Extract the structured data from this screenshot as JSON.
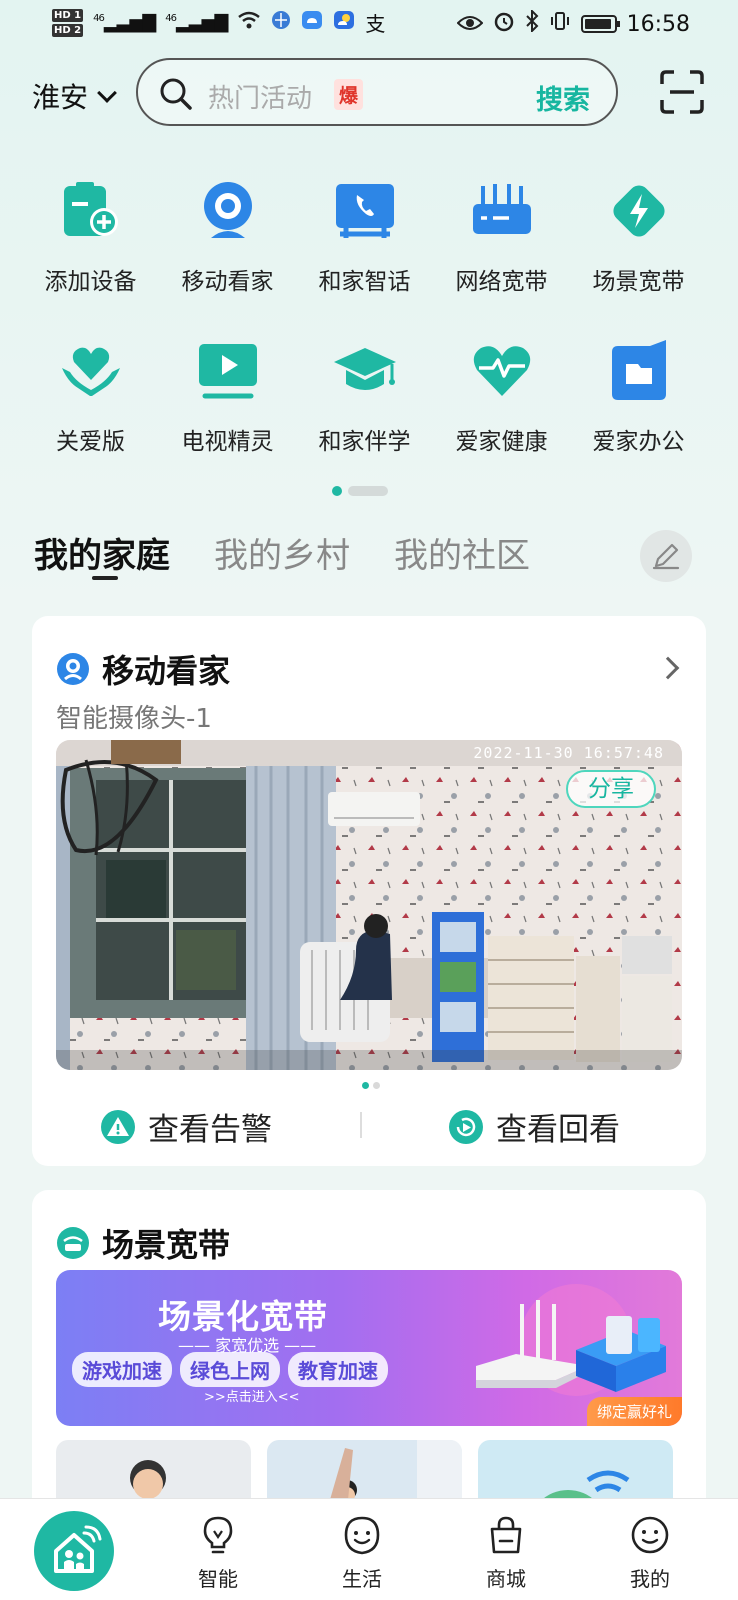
{
  "status_bar": {
    "hd1": "HD 1",
    "hd2": "HD 2",
    "signal1": "46",
    "signal2": "46",
    "alipay_icon": "支",
    "time": "16:58"
  },
  "header": {
    "city": "淮安",
    "search_placeholder": "热门活动",
    "hot_badge": "爆",
    "search_button": "搜索"
  },
  "grid": {
    "row1": [
      {
        "label": "添加设备",
        "icon": "add-device-icon"
      },
      {
        "label": "移动看家",
        "icon": "camera-icon"
      },
      {
        "label": "和家智话",
        "icon": "phone-icon"
      },
      {
        "label": "网络宽带",
        "icon": "router-icon"
      },
      {
        "label": "场景宽带",
        "icon": "lightning-icon"
      }
    ],
    "row2": [
      {
        "label": "关爱版",
        "icon": "heart-hands-icon"
      },
      {
        "label": "电视精灵",
        "icon": "tv-icon"
      },
      {
        "label": "和家伴学",
        "icon": "graduation-cap-icon"
      },
      {
        "label": "爱家健康",
        "icon": "health-heart-icon"
      },
      {
        "label": "爱家办公",
        "icon": "folder-icon"
      }
    ]
  },
  "tabs": [
    {
      "label": "我的家庭",
      "active": true
    },
    {
      "label": "我的乡村",
      "active": false
    },
    {
      "label": "我的社区",
      "active": false
    }
  ],
  "camera_card": {
    "title": "移动看家",
    "subtitle": "智能摄像头-1",
    "timestamp": "2022-11-30  16:57:48",
    "share": "分享",
    "alert_action": "查看告警",
    "replay_action": "查看回看"
  },
  "broadband_card": {
    "title": "场景宽带",
    "banner_title": "场景化宽带",
    "banner_sub": "—— 家宽优选 ——",
    "chips": [
      "游戏加速",
      "绿色上网",
      "教育加速"
    ],
    "banner_enter": ">>点击进入<<",
    "banner_gift": "绑定赢好礼"
  },
  "bottom_nav": [
    {
      "label": "智能",
      "icon": "bulb-icon"
    },
    {
      "label": "生活",
      "icon": "smile-face-icon"
    },
    {
      "label": "商城",
      "icon": "shopping-bag-icon"
    },
    {
      "label": "我的",
      "icon": "profile-face-icon"
    }
  ],
  "colors": {
    "accent": "#1fb8a3",
    "background": "#eef6f4",
    "card": "#ffffff"
  }
}
